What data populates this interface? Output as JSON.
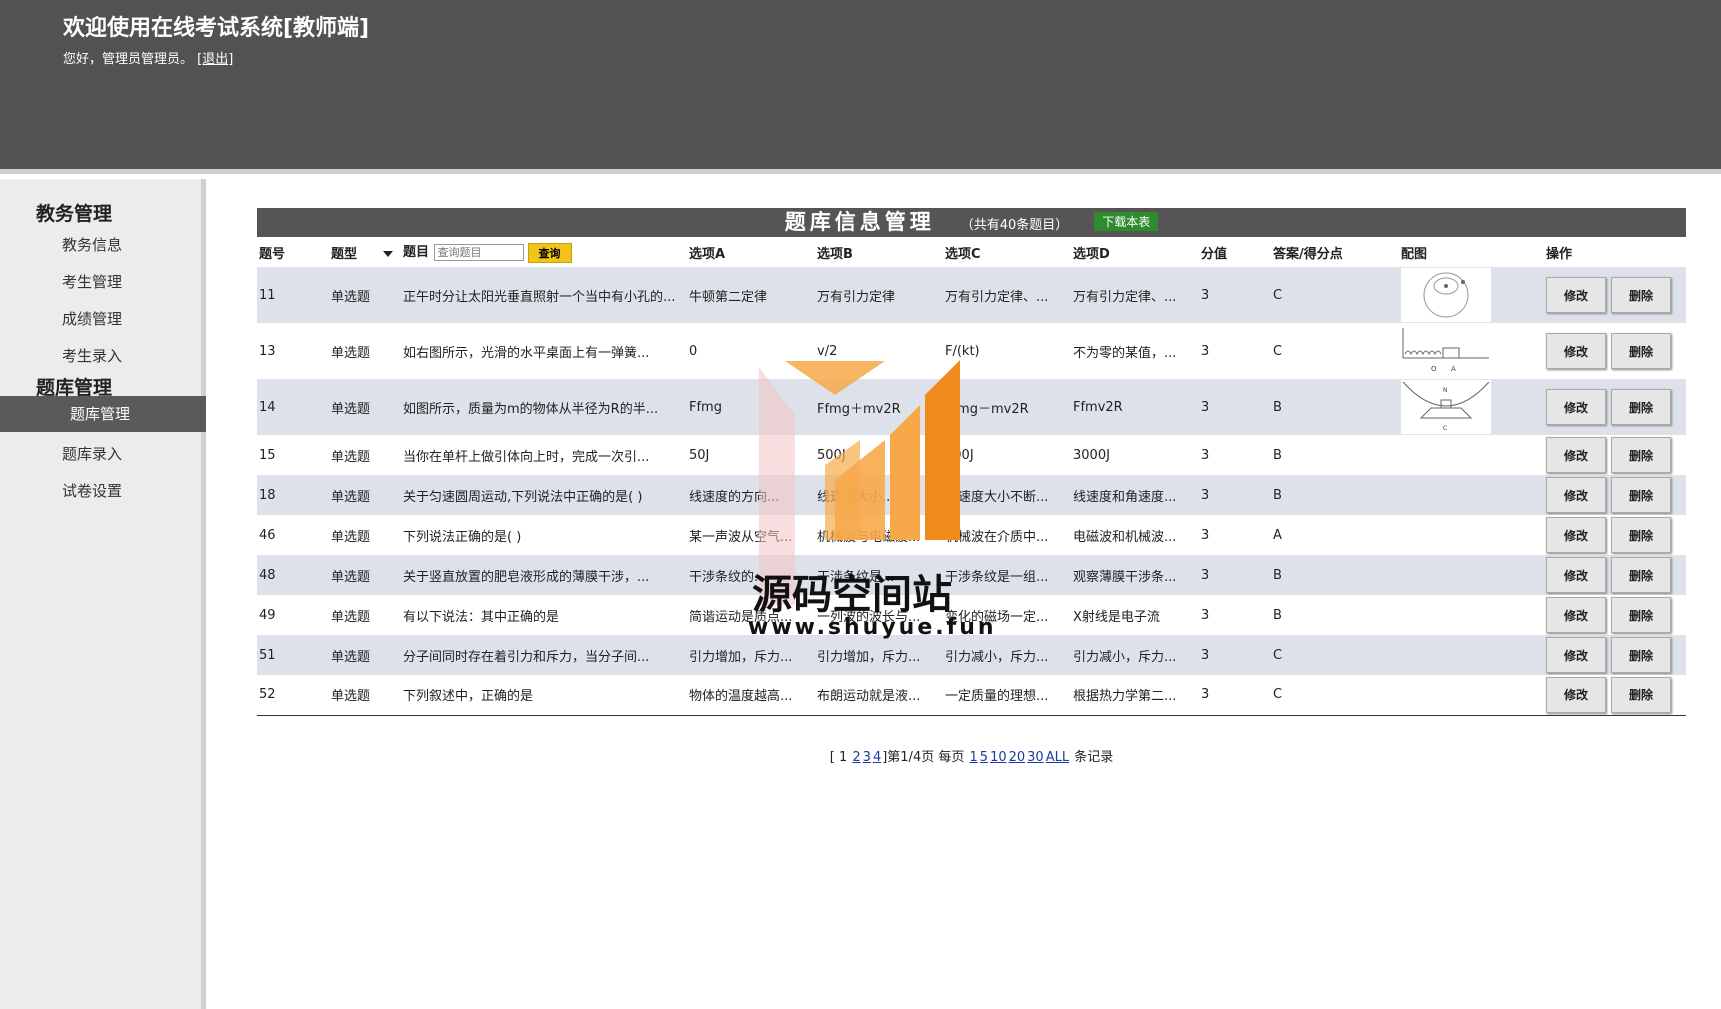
{
  "header": {
    "title": "欢迎使用在线考试系统[教师端]",
    "greeting": "您好，管理员管理员。",
    "logout": "[退出]"
  },
  "sidebar": {
    "groups": [
      {
        "title": "教务管理",
        "items": [
          "教务信息",
          "考生管理",
          "成绩管理",
          "考生录入"
        ]
      },
      {
        "title": "题库管理",
        "items": [
          "题库管理",
          "题库录入",
          "试卷设置"
        ]
      }
    ],
    "active": "题库管理"
  },
  "banner": {
    "title": "题库信息管理",
    "count": "（共有40条题目）",
    "download": "下载本表"
  },
  "table": {
    "headers": [
      "题号",
      "题型",
      "题目",
      "选项A",
      "选项B",
      "选项C",
      "选项D",
      "分值",
      "答案/得分点",
      "配图",
      "操作"
    ],
    "search_placeholder": "查询题目",
    "search_button": "查询",
    "edit_label": "修改",
    "delete_label": "删除",
    "rows": [
      {
        "id": "11",
        "type": "单选题",
        "q": "正午时分让太阳光垂直照射一个当中有小孔的...",
        "a": "牛顿第二定律",
        "b": "万有引力定律",
        "c": "万有引力定律、...",
        "d": "万有引力定律、...",
        "score": "3",
        "answer": "C",
        "image": "orbit-diagram"
      },
      {
        "id": "13",
        "type": "单选题",
        "q": "如右图所示，光滑的水平桌面上有一弹簧...",
        "a": "0",
        "b": "v/2",
        "c": "F/(kt)",
        "d": "不为零的某值，...",
        "score": "3",
        "answer": "C",
        "image": "spring-diagram"
      },
      {
        "id": "14",
        "type": "单选题",
        "q": "如图所示，质量为m的物体从半径为R的半...",
        "a": "Ffmg",
        "b": "Ffmg＋mv2R",
        "c": "Ffmg－mv2R",
        "d": "Ffmv2R",
        "score": "3",
        "answer": "B",
        "image": "bowl-diagram"
      },
      {
        "id": "15",
        "type": "单选题",
        "q": "当你在单杆上做引体向上时，完成一次引...",
        "a": "50J",
        "b": "500J",
        "c": "300J",
        "d": "3000J",
        "score": "3",
        "answer": "B",
        "image": ""
      },
      {
        "id": "18",
        "type": "单选题",
        "q": "关于匀速圆周运动,下列说法中正确的是( )",
        "a": "线速度的方向...",
        "b": "线速度大小...",
        "c": "线速度大小不断...",
        "d": "线速度和角速度...",
        "score": "3",
        "answer": "B",
        "image": ""
      },
      {
        "id": "46",
        "type": "单选题",
        "q": "下列说法正确的是( )",
        "a": "某一声波从空气...",
        "b": "机械波与电磁波...",
        "c": "机械波在介质中...",
        "d": "电磁波和机械波...",
        "score": "3",
        "answer": "A",
        "image": ""
      },
      {
        "id": "48",
        "type": "单选题",
        "q": "关于竖直放置的肥皂液形成的薄膜干涉，...",
        "a": "干涉条纹的...",
        "b": "干涉条纹是...",
        "c": "干涉条纹是一组...",
        "d": "观察薄膜干涉条...",
        "score": "3",
        "answer": "B",
        "image": ""
      },
      {
        "id": "49",
        "type": "单选题",
        "q": "有以下说法：其中正确的是",
        "a": "简谐运动是质点...",
        "b": "一列波的波长与...",
        "c": "变化的磁场一定...",
        "d": "X射线是电子流",
        "score": "3",
        "answer": "B",
        "image": ""
      },
      {
        "id": "51",
        "type": "单选题",
        "q": "分子间同时存在着引力和斥力，当分子间...",
        "a": "引力增加，斥力...",
        "b": "引力增加，斥力...",
        "c": "引力减小，斥力...",
        "d": "引力减小，斥力...",
        "score": "3",
        "answer": "C",
        "image": ""
      },
      {
        "id": "52",
        "type": "单选题",
        "q": "下列叙述中，正确的是",
        "a": "物体的温度越高...",
        "b": "布朗运动就是液...",
        "c": "一定质量的理想...",
        "d": "根据热力学第二...",
        "score": "3",
        "answer": "C",
        "image": ""
      }
    ]
  },
  "pager": {
    "pages_prefix": "[ 1",
    "pages": [
      "2",
      "3",
      "4"
    ],
    "pages_suffix": "]第1/4页 每页",
    "sizes": [
      "1",
      "5",
      "10",
      "20",
      "30",
      "ALL"
    ],
    "tail": "条记录"
  },
  "watermark": {
    "text": "源码空间站",
    "url": "www.shuyue.fun",
    "colors": [
      "#f08a1c",
      "#f7a94a",
      "#f3c2c2"
    ]
  }
}
